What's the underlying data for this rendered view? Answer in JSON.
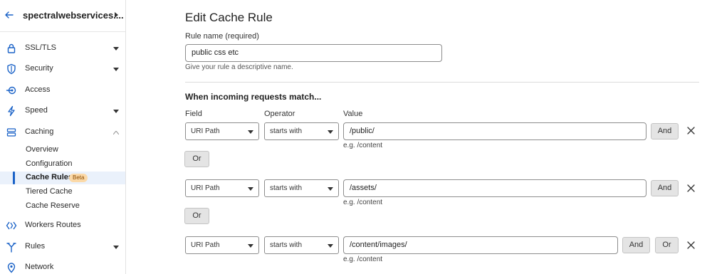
{
  "sidebar": {
    "site_name": "spectralwebservices....",
    "items": [
      {
        "label": "SSL/TLS"
      },
      {
        "label": "Security"
      },
      {
        "label": "Access"
      },
      {
        "label": "Speed"
      },
      {
        "label": "Caching"
      },
      {
        "label": "Workers Routes"
      },
      {
        "label": "Rules"
      },
      {
        "label": "Network"
      }
    ],
    "caching_sub": [
      {
        "label": "Overview"
      },
      {
        "label": "Configuration"
      },
      {
        "label": "Cache Rules",
        "badge": "Beta"
      },
      {
        "label": "Tiered Cache"
      },
      {
        "label": "Cache Reserve"
      }
    ]
  },
  "main": {
    "title": "Edit Cache Rule",
    "rule_name": {
      "label": "Rule name (required)",
      "value": "public css etc",
      "help": "Give your rule a descriptive name."
    },
    "section_title": "When incoming requests match...",
    "headers": {
      "field": "Field",
      "operator": "Operator",
      "value": "Value"
    },
    "conditions": [
      {
        "field": "URI Path",
        "operator": "starts with",
        "value": "/public/",
        "example": "e.g. /content",
        "and_label": "And",
        "or_label": "Or"
      },
      {
        "field": "URI Path",
        "operator": "starts with",
        "value": "/assets/",
        "example": "e.g. /content",
        "and_label": "And",
        "or_label": "Or"
      },
      {
        "field": "URI Path",
        "operator": "starts with",
        "value": "/content/images/",
        "example": "e.g. /content",
        "and_label": "And",
        "or_label": "Or"
      }
    ]
  },
  "colors": {
    "accent": "#1a62c7",
    "badge_bg": "#fbd9a8",
    "button_bg": "#e4e4e4"
  }
}
